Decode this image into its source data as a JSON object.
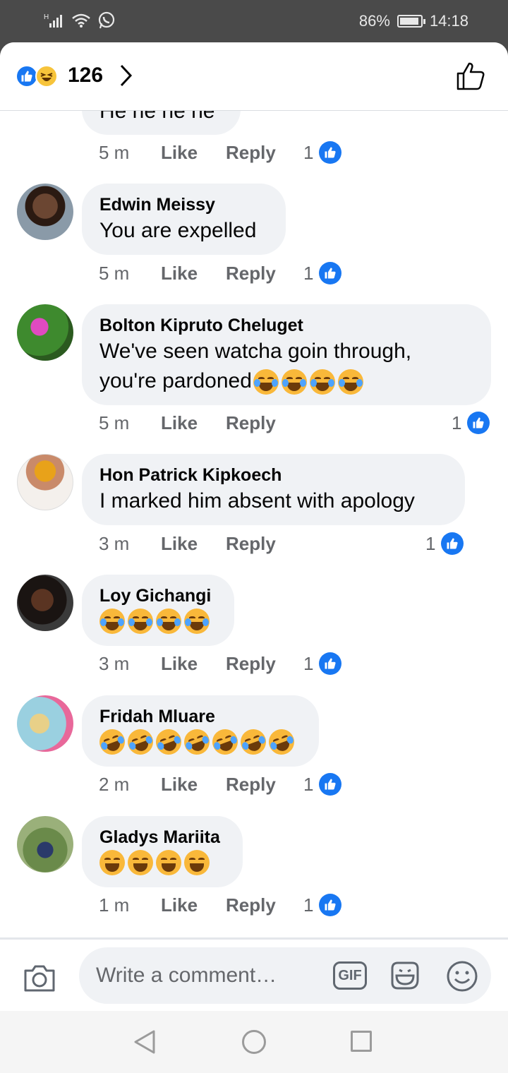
{
  "status_bar": {
    "signal_label": "H",
    "battery": "86%",
    "time": "14:18"
  },
  "header": {
    "reaction_count": "126"
  },
  "partial_comment": {
    "text": "He he he he",
    "time": "5 m",
    "like_label": "Like",
    "reply_label": "Reply",
    "likes": "1"
  },
  "comments": [
    {
      "name": "Edwin Meissy",
      "text": "You are expelled",
      "time": "5 m",
      "like_label": "Like",
      "reply_label": "Reply",
      "likes": "1"
    },
    {
      "name": "Bolton Kipruto Cheluget",
      "text_line1": "We've seen watcha goin through,",
      "text_line2": "you're pardoned",
      "time": "5 m",
      "like_label": "Like",
      "reply_label": "Reply",
      "likes": "1"
    },
    {
      "name": "Hon Patrick Kipkoech",
      "text": "I marked him absent with apology",
      "time": "3 m",
      "like_label": "Like",
      "reply_label": "Reply",
      "likes": "1"
    },
    {
      "name": "Loy Gichangi",
      "emoji": "😂😂😂😂",
      "time": "3 m",
      "like_label": "Like",
      "reply_label": "Reply",
      "likes": "1"
    },
    {
      "name": "Fridah Mluare",
      "emoji": "🤣🤣🤣🤣🤣🤣🤣",
      "time": "2 m",
      "like_label": "Like",
      "reply_label": "Reply",
      "likes": "1"
    },
    {
      "name": "Gladys Mariita",
      "emoji": "😆😆😆😆",
      "time": "1 m",
      "like_label": "Like",
      "reply_label": "Reply",
      "likes": "1"
    }
  ],
  "composer": {
    "placeholder": "Write a comment…",
    "gif_label": "GIF"
  },
  "colors": {
    "facebook_blue": "#1877f2",
    "bubble_bg": "#f0f2f5",
    "meta_gray": "#65676b",
    "status_bar_bg": "#4a4a4a"
  },
  "icons": [
    "whatsapp-icon",
    "wifi-icon",
    "like-reaction-icon",
    "haha-reaction-icon",
    "chevron-right-icon",
    "thumbs-up-outline-icon",
    "camera-icon",
    "gif-icon",
    "sticker-icon",
    "emoji-icon",
    "nav-back-icon",
    "nav-home-icon",
    "nav-recents-icon"
  ]
}
